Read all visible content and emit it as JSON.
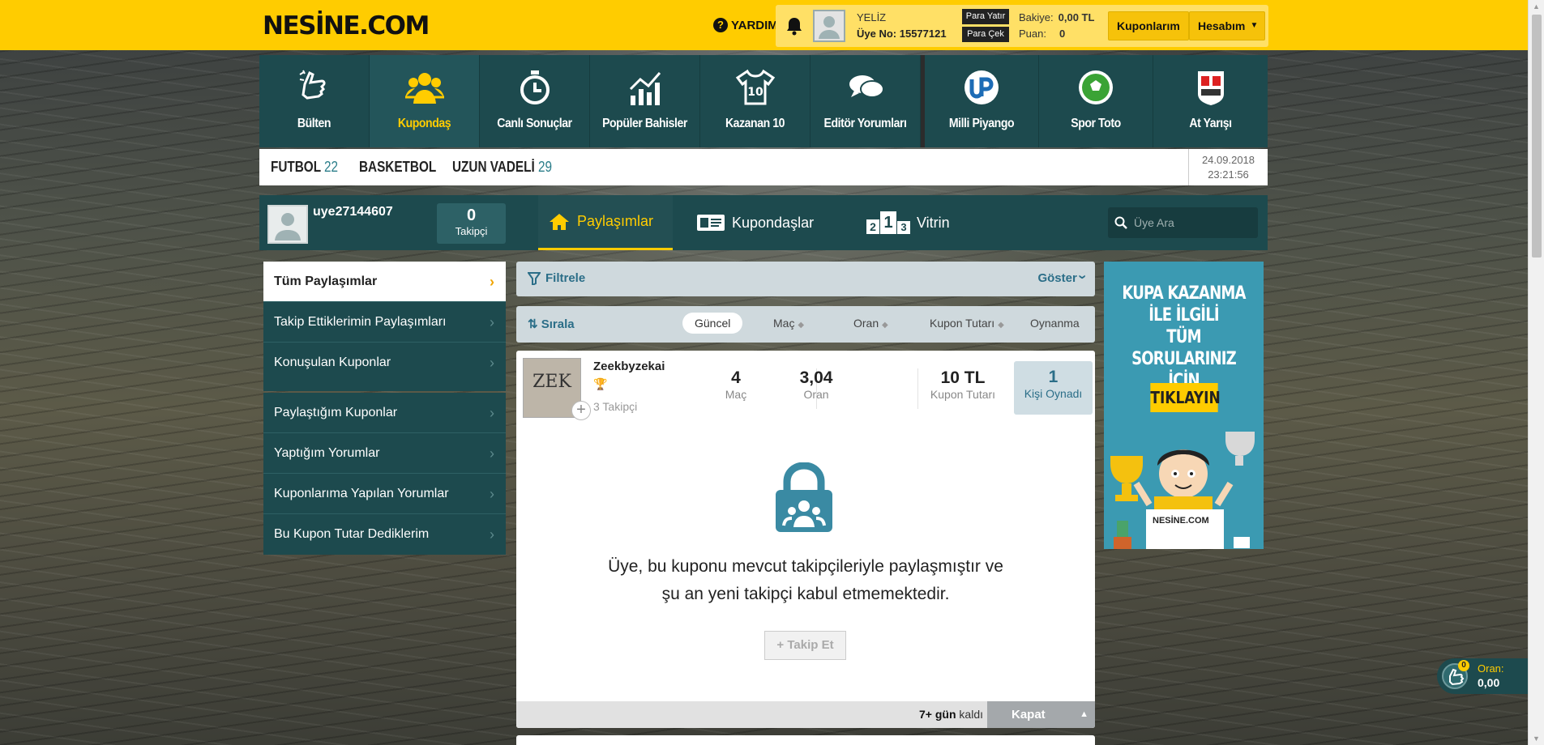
{
  "header": {
    "logo": "NESİNE.COM",
    "help_label": "YARDIM",
    "user_name": "YELİZ",
    "member_no": "Üye No: 15577121",
    "deposit_label": "Para Yatır",
    "withdraw_label": "Para Çek",
    "balance_label": "Bakiye:",
    "balance_value": "0,00 TL",
    "points_label": "Puan:",
    "points_value": "0",
    "coupons_button": "Kuponlarım",
    "account_button": "Hesabım"
  },
  "main_nav": [
    {
      "label": "Bülten",
      "icon": "hand-icon"
    },
    {
      "label": "Kupondaş",
      "icon": "group-icon"
    },
    {
      "label": "Canlı Sonuçlar",
      "icon": "stopwatch-icon"
    },
    {
      "label": "Popüler Bahisler",
      "icon": "chart-icon"
    },
    {
      "label": "Kazanan 10",
      "icon": "jersey-icon"
    },
    {
      "label": "Editör Yorumları",
      "icon": "chat-icon"
    },
    {
      "label": "Milli Piyango",
      "icon": "mp-logo-icon"
    },
    {
      "label": "Spor Toto",
      "icon": "ball-icon"
    },
    {
      "label": "At Yarışı",
      "icon": "horse-race-icon"
    }
  ],
  "sports_bar": {
    "futbol_label": "FUTBOL",
    "futbol_count": "22",
    "basketbol_label": "BASKETBOL",
    "uzun_label": "UZUN VADELİ",
    "uzun_count": "29",
    "date": "24.09.2018",
    "time": "23:21:56"
  },
  "profile": {
    "username": "uye27144607",
    "followers_count": "0",
    "followers_label": "Takipçi",
    "tabs": [
      {
        "label": "Paylaşımlar"
      },
      {
        "label": "Kupondaşlar"
      },
      {
        "label": "Vitrin",
        "badge": "213"
      }
    ],
    "search_placeholder": "Üye Ara"
  },
  "side_menu": {
    "group1": [
      "Tüm Paylaşımlar",
      "Takip Ettiklerimin Paylaşımları",
      "Konuşulan Kuponlar"
    ],
    "group2": [
      "Paylaştığım Kuponlar",
      "Yaptığım Yorumlar",
      "Kuponlarıma Yapılan Yorumlar",
      "Bu Kupon Tutar Dediklerim"
    ]
  },
  "filter": {
    "label": "Filtrele",
    "show_label": "Göster"
  },
  "sort": {
    "label": "Sırala",
    "options": [
      "Güncel",
      "Maç",
      "Oran",
      "Kupon Tutarı",
      "Oynanma"
    ]
  },
  "card": {
    "user": "Zeekbyzekai",
    "avatar_text": "ZEK",
    "followers": "3 Takipçi",
    "stats": [
      {
        "value": "4",
        "label": "Maç"
      },
      {
        "value": "3,04",
        "label": "Oran"
      },
      {
        "value": "10 TL",
        "label": "Kupon Tutarı"
      }
    ],
    "played_value": "1",
    "played_label": "Kişi Oynadı",
    "message_line1": "Üye, bu kuponu mevcut takipçileriyle paylaşmıştır ve",
    "message_line2": "şu an yeni takipçi kabul etmemektedir.",
    "follow_button": "Takip Et",
    "remaining_value": "7+ gün",
    "remaining_suffix": "kaldı",
    "close_button": "Kapat"
  },
  "ad": {
    "line1": "KUPA KAZANMA",
    "line2": "İLE İLGİLİ",
    "line3": "TÜM SORULARINIZ",
    "line4": "İÇİN",
    "button": "TIKLAYIN",
    "logo": "NESİNE.COM"
  },
  "coupon_float": {
    "badge": "0",
    "label": "Oran:",
    "value": "0,00"
  },
  "colors": {
    "brand_yellow": "#ffcc00",
    "nav_teal": "#1d4a4e",
    "accent_blue": "#2b6e88"
  }
}
